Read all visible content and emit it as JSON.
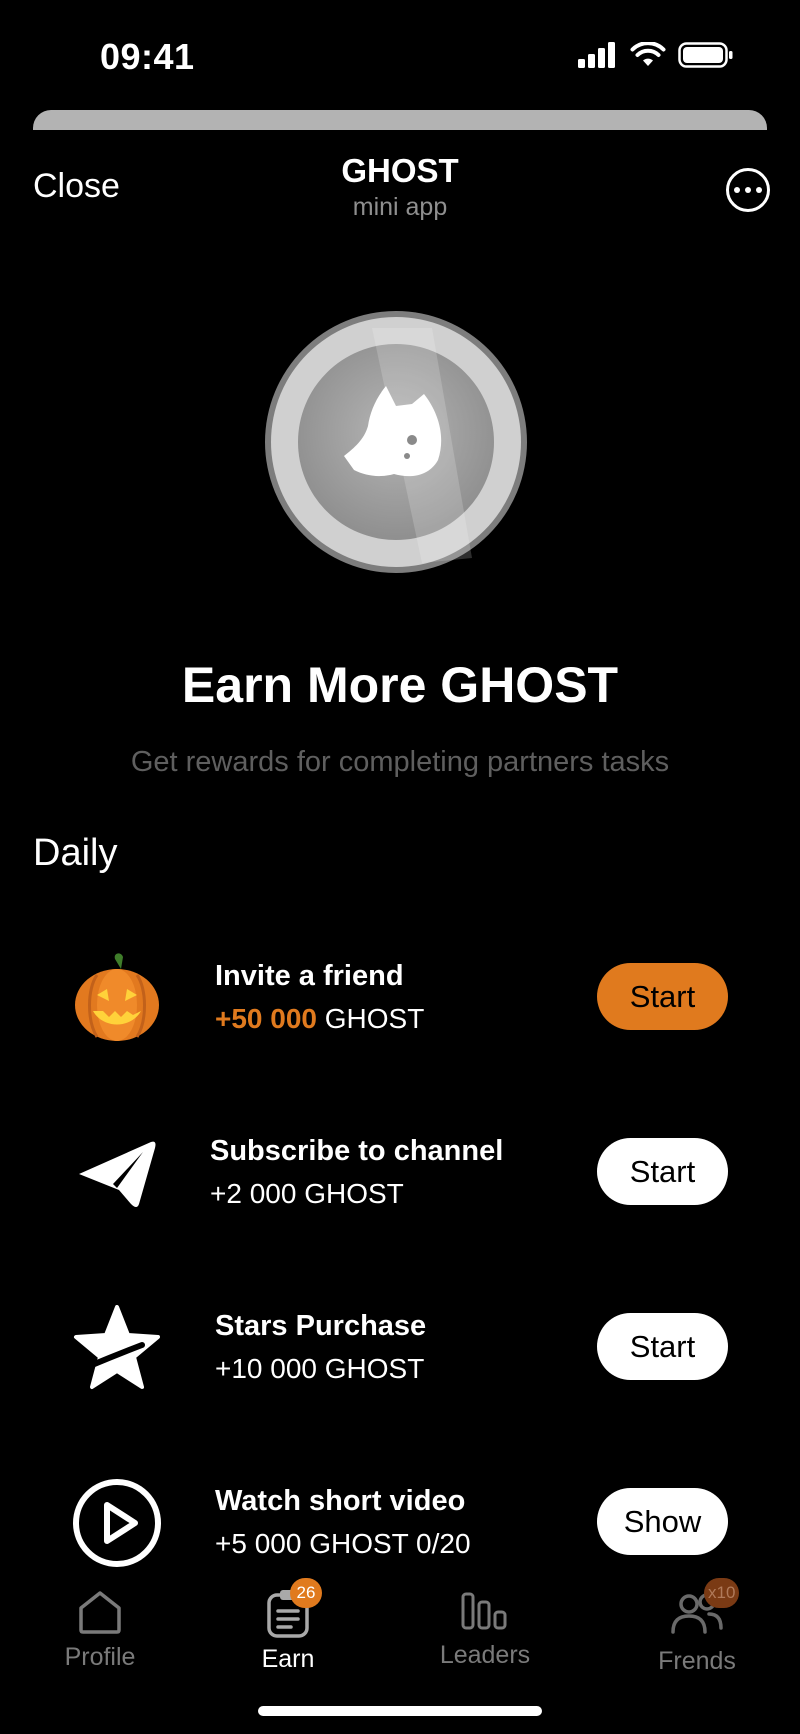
{
  "status_bar": {
    "time": "09:41"
  },
  "header": {
    "close_label": "Close",
    "title": "GHOST",
    "subtitle": "mini app",
    "more_icon": "ellipsis-circle-icon"
  },
  "hero": {
    "title": "Earn More GHOST",
    "subtitle": "Get rewards for completing partners tasks"
  },
  "section": {
    "title": "Daily"
  },
  "tasks": [
    {
      "icon": "pumpkin-icon",
      "title": "Invite a friend",
      "reward_amount": "+50 000",
      "reward_unit": " GHOST",
      "button": "Start",
      "button_color": "#e07a1e"
    },
    {
      "icon": "telegram-paper-plane-icon",
      "title": "Subscribe to channel",
      "reward": "+2 000 GHOST",
      "button": "Start"
    },
    {
      "icon": "star-icon",
      "title": "Stars Purchase",
      "reward": "+10 000 GHOST",
      "button": "Start"
    },
    {
      "icon": "play-circle-icon",
      "title": "Watch short video",
      "reward": "+5 000 GHOST 0/20",
      "button": "Show"
    }
  ],
  "nav": {
    "items": [
      {
        "label": "Profile",
        "icon": "home-icon"
      },
      {
        "label": "Earn",
        "icon": "clipboard-icon",
        "badge": "26",
        "active": true
      },
      {
        "label": "Leaders",
        "icon": "bar-chart-icon"
      },
      {
        "label": "Frends",
        "icon": "people-icon",
        "badge": "x10"
      }
    ]
  },
  "colors": {
    "accent": "#e07a1e",
    "background": "#000000"
  }
}
